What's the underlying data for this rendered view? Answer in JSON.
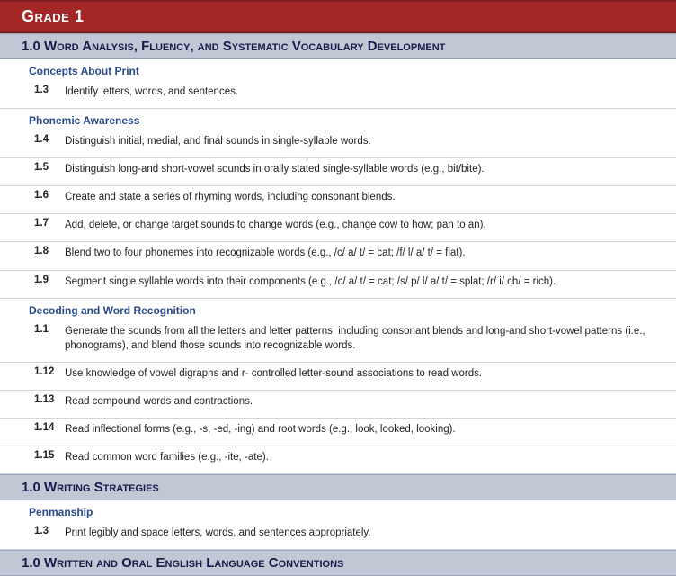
{
  "grade_title": "Grade 1",
  "sections": [
    {
      "heading": "1.0 Word Analysis, Fluency, and Systematic Vocabulary Development",
      "subsections": [
        {
          "title": "Concepts About Print",
          "standards": [
            {
              "num": "1.3",
              "text": "Identify letters, words, and sentences."
            }
          ]
        },
        {
          "title": "Phonemic Awareness",
          "standards": [
            {
              "num": "1.4",
              "text": "Distinguish initial, medial, and final sounds in single-syllable words."
            },
            {
              "num": "1.5",
              "text": "Distinguish long-and short-vowel sounds in orally stated single-syllable words (e.g., bit/bite)."
            },
            {
              "num": "1.6",
              "text": "Create and state a series of rhyming words, including consonant blends."
            },
            {
              "num": "1.7",
              "text": "Add, delete, or change target sounds to change words (e.g., change cow to how; pan to an)."
            },
            {
              "num": "1.8",
              "text": "Blend two to four phonemes into recognizable words (e.g., /c/ a/ t/ = cat; /f/ l/ a/ t/ = flat)."
            },
            {
              "num": "1.9",
              "text": "Segment single syllable words into their components (e.g., /c/ a/ t/ = cat; /s/ p/ l/ a/ t/ = splat; /r/ i/ ch/ = rich)."
            }
          ]
        },
        {
          "title": "Decoding and Word Recognition",
          "standards": [
            {
              "num": "1.1",
              "text": "Generate the sounds from all the letters and letter patterns, including consonant blends and long-and short-vowel patterns (i.e., phonograms), and blend those sounds into recognizable words."
            },
            {
              "num": "1.12",
              "text": "Use knowledge of vowel digraphs and r- controlled letter-sound associations to read words."
            },
            {
              "num": "1.13",
              "text": "Read compound words and contractions."
            },
            {
              "num": "1.14",
              "text": "Read inflectional forms (e.g., -s, -ed, -ing) and root words (e.g., look, looked, looking)."
            },
            {
              "num": "1.15",
              "text": "Read common word families (e.g., -ite, -ate)."
            }
          ]
        }
      ]
    },
    {
      "heading": "1.0 Writing Strategies",
      "subsections": [
        {
          "title": "Penmanship",
          "standards": [
            {
              "num": "1.3",
              "text": "Print legibly and space letters, words, and sentences appropriately."
            }
          ]
        }
      ]
    },
    {
      "heading": "1.0 Written and Oral English Language Conventions",
      "subsections": []
    }
  ]
}
